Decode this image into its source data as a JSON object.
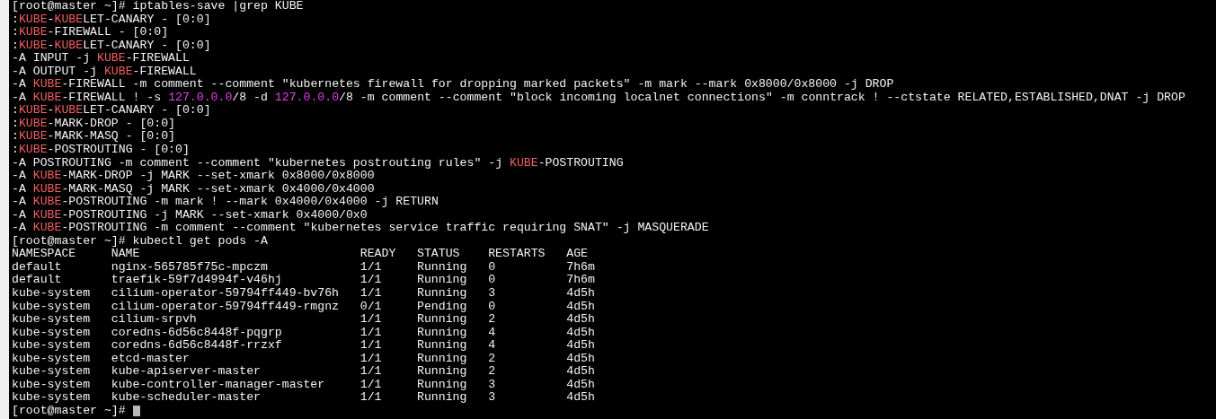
{
  "terminal": {
    "lines": [
      {
        "segments": [
          {
            "kind": "plain",
            "text": "[root@master ~]# iptables-save |grep KUBE"
          }
        ]
      },
      {
        "segments": [
          {
            "kind": "plain",
            "text": ":"
          },
          {
            "kind": "kube",
            "text": "KUBE"
          },
          {
            "kind": "plain",
            "text": "-"
          },
          {
            "kind": "kube",
            "text": "KUBE"
          },
          {
            "kind": "plain",
            "text": "LET-CANARY - [0:0]"
          }
        ]
      },
      {
        "segments": [
          {
            "kind": "plain",
            "text": ":"
          },
          {
            "kind": "kube",
            "text": "KUBE"
          },
          {
            "kind": "plain",
            "text": "-FIREWALL - [0:0]"
          }
        ]
      },
      {
        "segments": [
          {
            "kind": "plain",
            "text": ":"
          },
          {
            "kind": "kube",
            "text": "KUBE"
          },
          {
            "kind": "plain",
            "text": "-"
          },
          {
            "kind": "kube",
            "text": "KUBE"
          },
          {
            "kind": "plain",
            "text": "LET-CANARY - [0:0]"
          }
        ]
      },
      {
        "segments": [
          {
            "kind": "plain",
            "text": "-A INPUT -j "
          },
          {
            "kind": "kube",
            "text": "KUBE"
          },
          {
            "kind": "plain",
            "text": "-FIREWALL"
          }
        ]
      },
      {
        "segments": [
          {
            "kind": "plain",
            "text": "-A OUTPUT -j "
          },
          {
            "kind": "kube",
            "text": "KUBE"
          },
          {
            "kind": "plain",
            "text": "-FIREWALL"
          }
        ]
      },
      {
        "segments": [
          {
            "kind": "plain",
            "text": "-A "
          },
          {
            "kind": "kube",
            "text": "KUBE"
          },
          {
            "kind": "plain",
            "text": "-FIREWALL -m comment --comment \"kubernetes firewall for dropping marked packets\" -m mark --mark 0x8000/0x8000 -j DROP"
          }
        ]
      },
      {
        "segments": [
          {
            "kind": "plain",
            "text": "-A "
          },
          {
            "kind": "kube",
            "text": "KUBE"
          },
          {
            "kind": "plain",
            "text": "-FIREWALL ! -s "
          },
          {
            "kind": "ip",
            "text": "127.0.0.0"
          },
          {
            "kind": "plain",
            "text": "/8 -d "
          },
          {
            "kind": "ip",
            "text": "127.0.0.0"
          },
          {
            "kind": "plain",
            "text": "/8 -m comment --comment \"block incoming localnet connections\" -m conntrack ! --ctstate RELATED,ESTABLISHED,DNAT -j DROP"
          }
        ]
      },
      {
        "segments": [
          {
            "kind": "plain",
            "text": ":"
          },
          {
            "kind": "kube",
            "text": "KUBE"
          },
          {
            "kind": "plain",
            "text": "-"
          },
          {
            "kind": "kube",
            "text": "KUBE"
          },
          {
            "kind": "plain",
            "text": "LET-CANARY - [0:0]"
          }
        ]
      },
      {
        "segments": [
          {
            "kind": "plain",
            "text": ":"
          },
          {
            "kind": "kube",
            "text": "KUBE"
          },
          {
            "kind": "plain",
            "text": "-MARK-DROP - [0:0]"
          }
        ]
      },
      {
        "segments": [
          {
            "kind": "plain",
            "text": ":"
          },
          {
            "kind": "kube",
            "text": "KUBE"
          },
          {
            "kind": "plain",
            "text": "-MARK-MASQ - [0:0]"
          }
        ]
      },
      {
        "segments": [
          {
            "kind": "plain",
            "text": ":"
          },
          {
            "kind": "kube",
            "text": "KUBE"
          },
          {
            "kind": "plain",
            "text": "-POSTROUTING - [0:0]"
          }
        ]
      },
      {
        "segments": [
          {
            "kind": "plain",
            "text": "-A POSTROUTING -m comment --comment \"kubernetes postrouting rules\" -j "
          },
          {
            "kind": "kube",
            "text": "KUBE"
          },
          {
            "kind": "plain",
            "text": "-POSTROUTING"
          }
        ]
      },
      {
        "segments": [
          {
            "kind": "plain",
            "text": "-A "
          },
          {
            "kind": "kube",
            "text": "KUBE"
          },
          {
            "kind": "plain",
            "text": "-MARK-DROP -j MARK --set-xmark 0x8000/0x8000"
          }
        ]
      },
      {
        "segments": [
          {
            "kind": "plain",
            "text": "-A "
          },
          {
            "kind": "kube",
            "text": "KUBE"
          },
          {
            "kind": "plain",
            "text": "-MARK-MASQ -j MARK --set-xmark 0x4000/0x4000"
          }
        ]
      },
      {
        "segments": [
          {
            "kind": "plain",
            "text": "-A "
          },
          {
            "kind": "kube",
            "text": "KUBE"
          },
          {
            "kind": "plain",
            "text": "-POSTROUTING -m mark ! --mark 0x4000/0x4000 -j RETURN"
          }
        ]
      },
      {
        "segments": [
          {
            "kind": "plain",
            "text": "-A "
          },
          {
            "kind": "kube",
            "text": "KUBE"
          },
          {
            "kind": "plain",
            "text": "-POSTROUTING -j MARK --set-xmark 0x4000/0x0"
          }
        ]
      },
      {
        "segments": [
          {
            "kind": "plain",
            "text": "-A "
          },
          {
            "kind": "kube",
            "text": "KUBE"
          },
          {
            "kind": "plain",
            "text": "-POSTROUTING -m comment --comment \"kubernetes service traffic requiring SNAT\" -j MASQUERADE"
          }
        ]
      },
      {
        "segments": [
          {
            "kind": "plain",
            "text": "[root@master ~]# kubectl get pods -A"
          }
        ]
      }
    ],
    "pods_table": {
      "columns": [
        "NAMESPACE",
        "NAME",
        "READY",
        "STATUS",
        "RESTARTS",
        "AGE"
      ],
      "rows": [
        [
          "default",
          "nginx-565785f75c-mpczm",
          "1/1",
          "Running",
          "0",
          "7h6m"
        ],
        [
          "default",
          "traefik-59f7d4994f-v46hj",
          "1/1",
          "Running",
          "0",
          "7h6m"
        ],
        [
          "kube-system",
          "cilium-operator-59794ff449-bv76h",
          "1/1",
          "Running",
          "3",
          "4d5h"
        ],
        [
          "kube-system",
          "cilium-operator-59794ff449-rmgnz",
          "0/1",
          "Pending",
          "0",
          "4d5h"
        ],
        [
          "kube-system",
          "cilium-srpvh",
          "1/1",
          "Running",
          "2",
          "4d5h"
        ],
        [
          "kube-system",
          "coredns-6d56c8448f-pqgrp",
          "1/1",
          "Running",
          "4",
          "4d5h"
        ],
        [
          "kube-system",
          "coredns-6d56c8448f-rrzxf",
          "1/1",
          "Running",
          "4",
          "4d5h"
        ],
        [
          "kube-system",
          "etcd-master",
          "1/1",
          "Running",
          "2",
          "4d5h"
        ],
        [
          "kube-system",
          "kube-apiserver-master",
          "1/1",
          "Running",
          "2",
          "4d5h"
        ],
        [
          "kube-system",
          "kube-controller-manager-master",
          "1/1",
          "Running",
          "3",
          "4d5h"
        ],
        [
          "kube-system",
          "kube-scheduler-master",
          "1/1",
          "Running",
          "3",
          "4d5h"
        ]
      ]
    },
    "current_prompt": "[root@master ~]#"
  }
}
